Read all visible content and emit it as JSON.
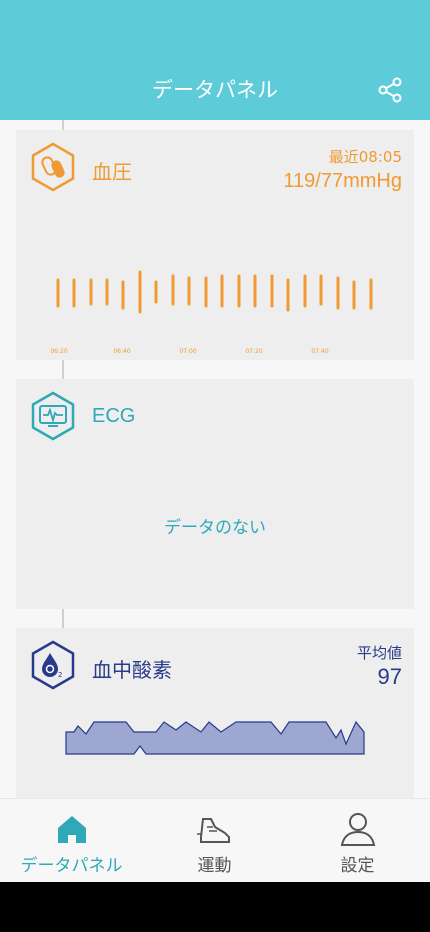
{
  "header": {
    "title": "データパネル",
    "share_icon": "share-icon"
  },
  "blood_pressure": {
    "title": "血圧",
    "latest_label": "最近08:05",
    "value": "119/77mmHg",
    "color": "#f09a33",
    "icon": "capsule-icon",
    "x_ticks": [
      "06:20",
      "06:40",
      "07:00",
      "07:20",
      "07:40"
    ]
  },
  "ecg": {
    "title": "ECG",
    "empty_text": "データのない",
    "color": "#2fa8b8",
    "icon": "ecg-monitor-icon"
  },
  "spo2": {
    "title": "血中酸素",
    "avg_label": "平均値",
    "avg_value": "97",
    "color": "#283a8a",
    "icon": "oxygen-drop-icon"
  },
  "tabs": [
    {
      "label": "データパネル",
      "icon": "home-icon",
      "active": true
    },
    {
      "label": "運動",
      "icon": "shoe-icon",
      "active": false
    },
    {
      "label": "設定",
      "icon": "person-icon",
      "active": false
    }
  ],
  "colors": {
    "accent": "#5ecbd8",
    "active_tab": "#2fa8b8",
    "inactive_tab": "#555555"
  }
}
